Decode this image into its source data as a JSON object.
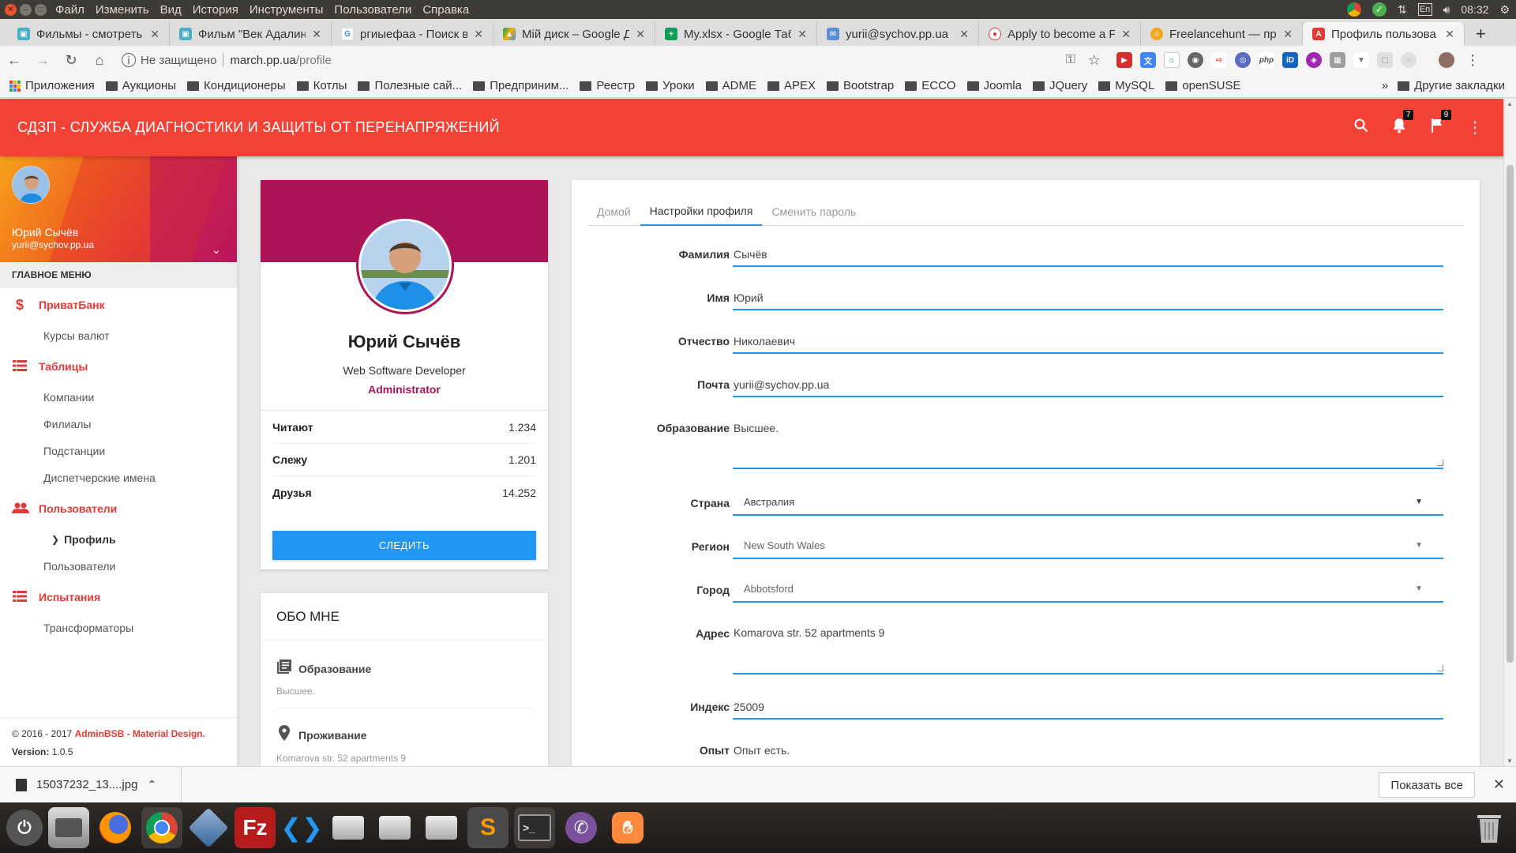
{
  "os": {
    "menu": [
      "Файл",
      "Изменить",
      "Вид",
      "История",
      "Инструменты",
      "Пользователи",
      "Справка"
    ],
    "keyboard_layout": "En",
    "clock": "08:32"
  },
  "browser": {
    "tabs": [
      {
        "title": "Фильмы - смотреть",
        "favicon": "film-icon",
        "color": "#4ab0c1"
      },
      {
        "title": "Фильм \"Век Адалин",
        "favicon": "film-icon",
        "color": "#4ab0c1"
      },
      {
        "title": "ргиыефаа - Поиск в",
        "favicon": "google-icon",
        "color": "#4285f4"
      },
      {
        "title": "Мій диск – Google Д",
        "favicon": "drive-icon",
        "color": "#0f9d58"
      },
      {
        "title": "My.xlsx - Google Таб",
        "favicon": "sheets-icon",
        "color": "#0f9d58"
      },
      {
        "title": "yurii@sychov.pp.ua",
        "favicon": "mail-icon",
        "color": "#5b8fd8"
      },
      {
        "title": "Apply to become a F",
        "favicon": "freelancer-icon",
        "color": "#e53935"
      },
      {
        "title": "Freelancehunt — пр",
        "favicon": "freelancehunt-icon",
        "color": "#f4a51c"
      },
      {
        "title": "Профиль пользова",
        "favicon": "adminbsb-icon",
        "color": "#e53935",
        "active": true
      }
    ],
    "security_label": "Не защищено",
    "url_host": "march.pp.ua",
    "url_path": "/profile",
    "bookmarks": [
      "Приложения",
      "Аукционы",
      "Кондиционеры",
      "Котлы",
      "Полезные сай...",
      "Предприним...",
      "Реестр",
      "Уроки",
      "ADME",
      "APEX",
      "Bootstrap",
      "ECCO",
      "Joomla",
      "JQuery",
      "MySQL",
      "openSUSE"
    ],
    "bookmarks_more": "»",
    "other_bookmarks": "Другие закладки"
  },
  "app": {
    "brand": "СДЗП - СЛУЖБА ДИАГНОСТИКИ И ЗАЩИТЫ ОТ ПЕРЕНАПРЯЖЕНИЙ",
    "notifications_count": "7",
    "tasks_count": "9",
    "accent": "#f44336"
  },
  "sidebar": {
    "user_name": "Юрий Сычёв",
    "user_email": "yurii@sychov.pp.ua",
    "menu_header": "ГЛАВНОЕ МЕНЮ",
    "sections": [
      {
        "label": "ПриватБанк",
        "icon": "dollar-icon",
        "items": [
          "Курсы валют"
        ]
      },
      {
        "label": "Таблицы",
        "icon": "table-list-icon",
        "items": [
          "Компании",
          "Филиалы",
          "Подстанции",
          "Диспетчерские имена"
        ]
      },
      {
        "label": "Пользователи",
        "icon": "users-icon",
        "items": [
          "Профиль",
          "Пользователи"
        ],
        "active_item": "Профиль"
      },
      {
        "label": "Испытания",
        "icon": "table-list-icon",
        "items": [
          "Трансформаторы"
        ]
      }
    ],
    "footer_copyright": "© 2016 - 2017 ",
    "footer_brand": "AdminBSB - Material Design.",
    "footer_version_label": "Version: ",
    "footer_version": "1.0.5"
  },
  "profile": {
    "name": "Юрий Сычёв",
    "title": "Web Software Developer",
    "role": "Administrator",
    "stats": [
      {
        "label": "Читают",
        "value": "1.234"
      },
      {
        "label": "Слежу",
        "value": "1.201"
      },
      {
        "label": "Друзья",
        "value": "14.252"
      }
    ],
    "follow_button": "СЛЕДИТЬ"
  },
  "about": {
    "header": "ОБО МНЕ",
    "education_title": "Образование",
    "education_value": "Высшее.",
    "residence_title": "Проживание",
    "residence_value": "Komarova str. 52 apartments 9"
  },
  "settings": {
    "tabs": [
      "Домой",
      "Настройки профиля",
      "Сменить пароль"
    ],
    "active_tab": "Настройки профиля",
    "fields": {
      "last_name": {
        "label": "Фамилия",
        "value": "Сычёв"
      },
      "first_name": {
        "label": "Имя",
        "value": "Юрий"
      },
      "patronymic": {
        "label": "Отчество",
        "value": "Николаевич"
      },
      "email": {
        "label": "Почта",
        "value": "yurii@sychov.pp.ua"
      },
      "education": {
        "label": "Образование",
        "value": "Высшее."
      },
      "country": {
        "label": "Страна",
        "value": "Австралия"
      },
      "region": {
        "label": "Регион",
        "value": "New South Wales"
      },
      "city": {
        "label": "Город",
        "value": "Abbotsford"
      },
      "address": {
        "label": "Адрес",
        "value": "Komarova str. 52 apartments 9"
      },
      "postcode": {
        "label": "Индекс",
        "value": "25009"
      },
      "experience": {
        "label": "Опыт",
        "value": "Опыт есть."
      }
    }
  },
  "downloads": {
    "file": "15037232_13....jpg",
    "show_all": "Показать все"
  }
}
